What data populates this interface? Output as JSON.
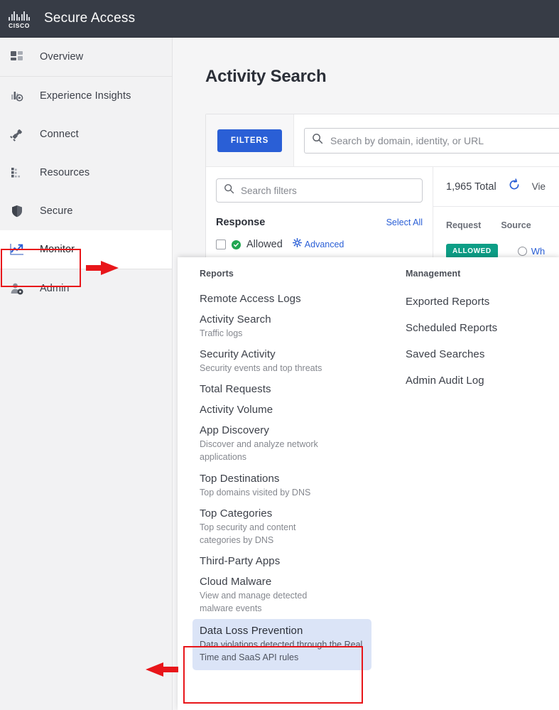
{
  "header": {
    "logo_name": "cisco-logo",
    "logo_word": "CISCO",
    "app_title": "Secure Access",
    "bg_color": "#373c46"
  },
  "sidebar": {
    "items": [
      {
        "label": "Overview",
        "icon": "dashboard-grid-icon",
        "active": false
      },
      {
        "label": "Experience Insights",
        "icon": "bar-chart-eye-icon",
        "active": false
      },
      {
        "label": "Connect",
        "icon": "plug-connect-icon",
        "active": false
      },
      {
        "label": "Resources",
        "icon": "resources-blocks-icon",
        "active": false
      },
      {
        "label": "Secure",
        "icon": "shield-icon",
        "active": false
      },
      {
        "label": "Monitor",
        "icon": "trending-chart-icon",
        "active": true
      },
      {
        "label": "Admin",
        "icon": "user-gear-icon",
        "active": false
      }
    ]
  },
  "main": {
    "page_title": "Activity Search",
    "toolbar": {
      "filters_label": "FILTERS",
      "search_placeholder": "Search by domain, identity, or URL",
      "search_value": "",
      "search_icon": "search-icon"
    },
    "filter_panel": {
      "search_placeholder": "Search filters",
      "search_value": "",
      "search_icon": "search-icon",
      "section_title": "Response",
      "select_all_label": "Select All",
      "options": [
        {
          "label": "Allowed",
          "checked": false,
          "status_color": "#21a651"
        }
      ],
      "advanced_label": "Advanced",
      "advanced_icon": "gear-icon"
    },
    "results": {
      "total_label": "1,965 Total",
      "refresh_icon": "refresh-icon",
      "view_label": "Vie",
      "columns": [
        "Request",
        "Source"
      ],
      "first_row": {
        "response_badge": "ALLOWED",
        "source_icon": "circle-icon",
        "source_label": "Wh"
      }
    }
  },
  "menu": {
    "columns": [
      {
        "heading": "Reports",
        "items": [
          {
            "title": "Remote Access Logs",
            "desc": "",
            "selected": false
          },
          {
            "title": "Activity Search",
            "desc": "Traffic logs",
            "selected": false
          },
          {
            "title": "Security Activity",
            "desc": "Security events and top threats",
            "selected": false
          },
          {
            "title": "Total Requests",
            "desc": "",
            "selected": false
          },
          {
            "title": "Activity Volume",
            "desc": "",
            "selected": false
          },
          {
            "title": "App Discovery",
            "desc": "Discover and analyze network applications",
            "selected": false
          },
          {
            "title": "Top Destinations",
            "desc": "Top domains visited by DNS",
            "selected": false
          },
          {
            "title": "Top Categories",
            "desc": "Top security and content categories by DNS",
            "selected": false
          },
          {
            "title": "Third-Party Apps",
            "desc": "",
            "selected": false
          },
          {
            "title": "Cloud Malware",
            "desc": "View and manage detected malware events",
            "selected": false
          },
          {
            "title": "Data Loss Prevention",
            "desc": "Data violations detected through the Real Time and SaaS API rules",
            "selected": true
          }
        ]
      },
      {
        "heading": "Management",
        "items": [
          {
            "title": "Exported Reports",
            "desc": "",
            "selected": false
          },
          {
            "title": "Scheduled Reports",
            "desc": "",
            "selected": false
          },
          {
            "title": "Saved Searches",
            "desc": "",
            "selected": false
          },
          {
            "title": "Admin Audit Log",
            "desc": "",
            "selected": false
          }
        ]
      }
    ]
  },
  "annotations": {
    "color": "#e8161a",
    "boxes": [
      "monitor-nav-item",
      "data-loss-prevention-menu-item"
    ],
    "arrows": [
      "arrow-pointing-to-monitor",
      "arrow-pointing-to-data-loss-prevention"
    ]
  },
  "colors": {
    "accent_blue": "#2a5fd6",
    "header_bg": "#373c46",
    "sidebar_bg": "#f2f2f3",
    "selection_bg": "#dbe4f7",
    "annotation_red": "#e8161a",
    "allowed_green": "#21a651",
    "badge_teal": "#0d9e86"
  }
}
